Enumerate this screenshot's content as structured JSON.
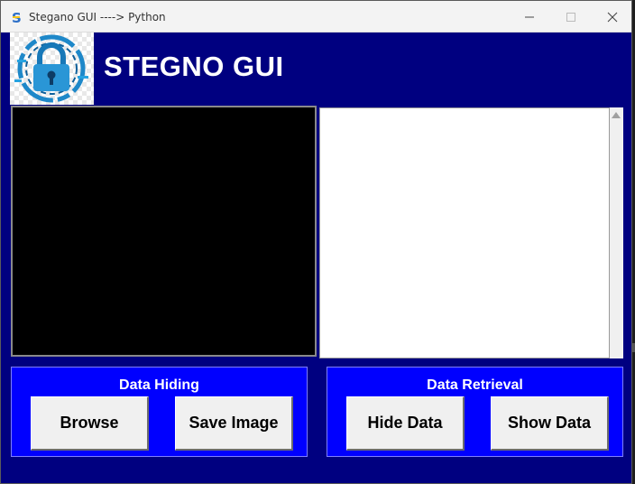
{
  "window": {
    "title": "Stegano GUI ----> Python",
    "icon": "python-s-icon",
    "controls": [
      "minimize-icon",
      "maximize-icon",
      "close-icon"
    ]
  },
  "header": {
    "logo": "padlock-logo",
    "title": "STEGNO GUI"
  },
  "preview": {
    "background": "#000000"
  },
  "message_box": {
    "text": ""
  },
  "panels": {
    "hiding": {
      "label": "Data Hiding",
      "browse_label": "Browse",
      "save_label": "Save Image"
    },
    "retrieval": {
      "label": "Data Retrieval",
      "hide_label": "Hide Data",
      "show_label": "Show Data"
    }
  },
  "colors": {
    "window_bg": "#000080",
    "panel_bg": "#0000ff",
    "button_bg": "#f0f0f0"
  }
}
